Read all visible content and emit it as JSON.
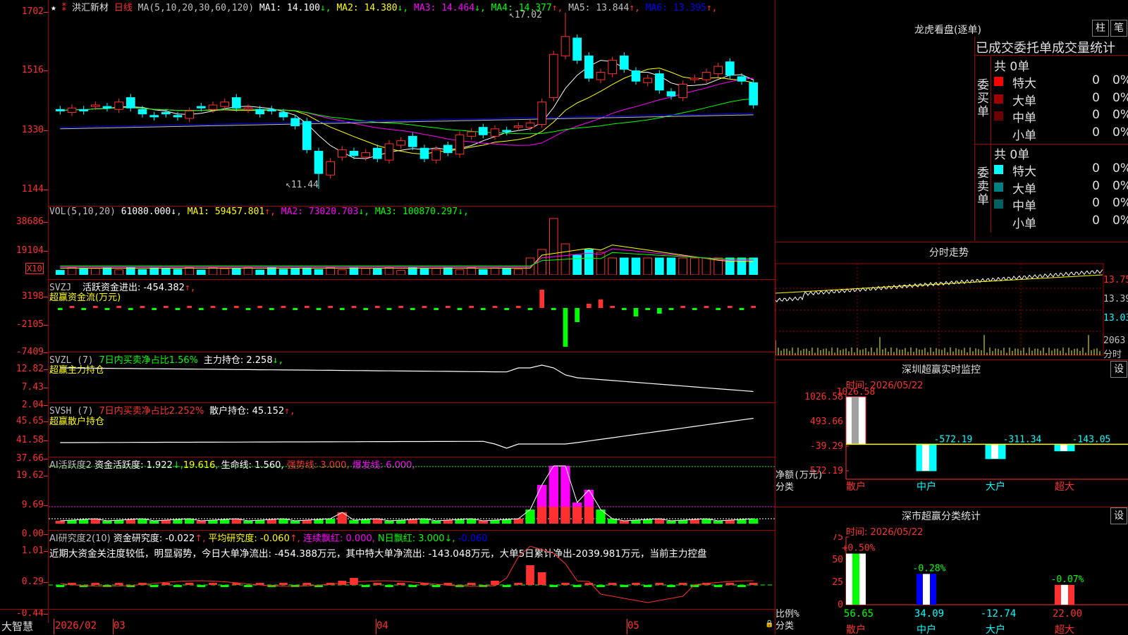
{
  "app": {
    "name": "大智慧",
    "stock_name": "洪汇新材",
    "period": "日线",
    "star": "★"
  },
  "timeline": {
    "labels": [
      "2026/02",
      "03",
      "04",
      "05"
    ]
  },
  "price_panel": {
    "ma_params": "MA(5,10,20,30,60,120)",
    "ma": [
      {
        "label": "MA1:",
        "value": "14.100",
        "arrow": "↓",
        "color": "#ffffff"
      },
      {
        "label": "MA2:",
        "value": "14.380",
        "arrow": "↓",
        "color": "#ffff00"
      },
      {
        "label": "MA3:",
        "value": "14.464",
        "arrow": "↓",
        "color": "#ff00ff"
      },
      {
        "label": "MA4:",
        "value": "14.377",
        "arrow": "↑",
        "color": "#00ff00"
      },
      {
        "label": "MA5:",
        "value": "13.844",
        "arrow": "↑",
        "color": "#c0c0c0"
      },
      {
        "label": "MA6:",
        "value": "13.395",
        "arrow": "↑",
        "color": "#0000ff"
      }
    ],
    "y_labels": [
      "1702",
      "1516",
      "1330",
      "1144"
    ],
    "high_mark": "17.02",
    "low_mark": "11.44"
  },
  "vol_panel": {
    "title": "VOL(5,10,20)",
    "value": "61080.000",
    "arrow": "↓",
    "ma": [
      {
        "label": "MA1:",
        "value": "59457.801",
        "arrow": "↑",
        "color": "#ffff00"
      },
      {
        "label": "MA2:",
        "value": "73020.703",
        "arrow": "↓",
        "color": "#ff00ff"
      },
      {
        "label": "MA3:",
        "value": "100870.297",
        "arrow": "↓",
        "color": "#00ff00"
      }
    ],
    "y_labels": [
      "38686",
      "19104"
    ],
    "unit": "X10"
  },
  "svzj_panel": {
    "title": "SVZJ",
    "line1": "活跃资金进出: -454.382",
    "arrow": "↑,",
    "subtitle": "超赢资金流(万元)",
    "y_labels": [
      "3198",
      "-2105",
      "-7409"
    ]
  },
  "svzl_panel": {
    "title": "SVZL (7)",
    "green_text": "7日内买卖净占比1.56%",
    "white_text": "主力持仓: 2.258",
    "arrow": "↓,",
    "subtitle": "超赢主力持仓",
    "y_labels": [
      "12.82",
      "7.43",
      "2.04"
    ]
  },
  "svsh_panel": {
    "title": "SVSH (7)",
    "red_text": "7日内买卖净占比2.252%",
    "white_text": "散户持仓: 45.152",
    "arrow": "↑,",
    "subtitle": "超赢散户持仓",
    "y_labels": [
      "45.65",
      "41.58",
      "37.66"
    ]
  },
  "ai_active_panel": {
    "title": "AI活跃度2",
    "t1": "资金活跃度: 1.922",
    "t2": "19.616",
    "t3": "生命线: 1.560,",
    "t4": "强势线: 3.000,",
    "t5": "爆发线: 6.000,",
    "y_labels": [
      "19.62",
      "9.69",
      "0.00"
    ]
  },
  "ai_research_panel": {
    "title": "AI研究度2(10)",
    "t1": "资金研究度: -0.022",
    "t2": "平均研究度: -0.060",
    "t3": "连续飘红: 0.000,",
    "t4": "N日飘红: 3.000",
    "t5": "-0.060",
    "comment": "近期大资金关注度较低，明显弱势，今日大单净流出: -454.388万元，其中特大单净流出: -143.048万元，大单5日累计净出-2039.981万元，当前主力控盘",
    "y_labels": [
      "1.01",
      "0.29",
      "-0.44"
    ]
  },
  "dragon_panel": {
    "title": "龙虎看盘(逐单)",
    "btn1": "柱",
    "btn2": "笔",
    "header": "已成交委托单成交量统计",
    "buy": {
      "side_label": "委买单",
      "count": "共 0单",
      "rows": [
        {
          "label": "特大",
          "v1": "0",
          "v2": "0%",
          "color": "#ff0000"
        },
        {
          "label": "大单",
          "v1": "0",
          "v2": "0%",
          "color": "#a00000"
        },
        {
          "label": "中单",
          "v1": "0",
          "v2": "0%",
          "color": "#6a0000"
        },
        {
          "label": "小单",
          "v1": "0",
          "v2": "0%",
          "color": "#000000"
        }
      ]
    },
    "sell": {
      "side_label": "委卖单",
      "count": "共 0单",
      "rows": [
        {
          "label": "特大",
          "v1": "0",
          "v2": "0%",
          "color": "#00ffff"
        },
        {
          "label": "大单",
          "v1": "0",
          "v2": "0%",
          "color": "#008080"
        },
        {
          "label": "中单",
          "v1": "0",
          "v2": "0%",
          "color": "#006060"
        },
        {
          "label": "小单",
          "v1": "0",
          "v2": "0%",
          "color": "#000000"
        }
      ]
    }
  },
  "intraday_panel": {
    "title": "分时走势",
    "y_labels": [
      "13.75",
      "13.39",
      "13.03"
    ],
    "vol_label": "2063",
    "unit": "分时"
  },
  "monitor_panel": {
    "title": "深圳超赢实时监控",
    "btn": "设",
    "time": "时间: 2026/05/22",
    "y_labels": [
      "1026.58",
      "493.66",
      "-39.29",
      "-572.19"
    ],
    "ylabel": "净额(万元)",
    "xlabel": "分类",
    "chart_data": {
      "type": "bar",
      "categories": [
        "散户",
        "中户",
        "大户",
        "超大"
      ],
      "values": [
        1026.58,
        -572.19,
        -311.34,
        -143.05
      ],
      "ylim": [
        -572.19,
        1026.58
      ],
      "value_labels": [
        "1026.58",
        "-572.19",
        "-311.34",
        "-143.05"
      ]
    }
  },
  "class_panel": {
    "title": "深市超赢分类统计",
    "btn": "设",
    "time": "时间: 2026/05/22",
    "y_labels": [
      "75",
      "50",
      "25",
      "0"
    ],
    "ylabel": "比例%",
    "xlabel": "分类",
    "chart_data": {
      "type": "bar",
      "categories": [
        "散户",
        "中户",
        "大户",
        "超大"
      ],
      "values": [
        56.65,
        34.09,
        -12.74,
        22.0
      ],
      "ratio_labels": [
        "+0.50%",
        "-0.28%",
        "",
        "-0.07%"
      ],
      "value_labels": [
        "56.65",
        "34.09",
        "-12.74",
        "22.00"
      ],
      "ylim": [
        0,
        75
      ]
    }
  }
}
